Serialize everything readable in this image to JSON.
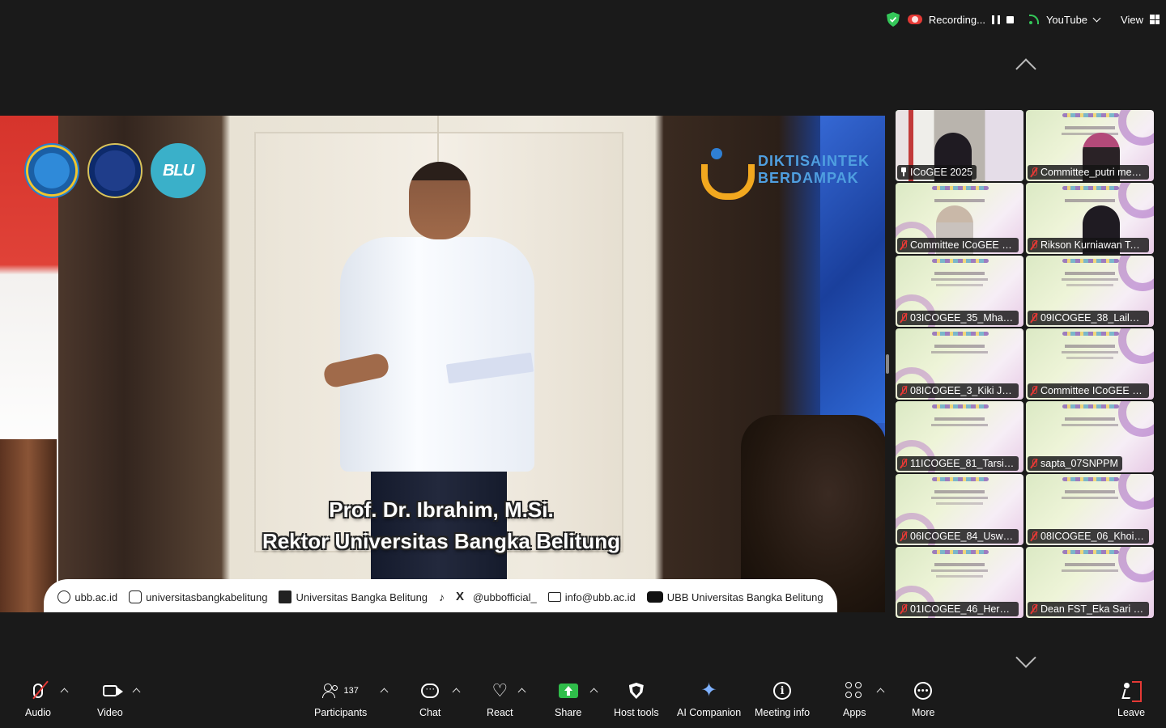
{
  "status_bar": {
    "recording_label": "Recording...",
    "livestream_label": "YouTube",
    "view_label": "View",
    "accent_green": "#34c759",
    "recording_color": "#e53935"
  },
  "main_video": {
    "caption_name": "Prof. Dr. Ibrahim, M.Si.",
    "caption_title": "Rektor Universitas Bangka Belitung",
    "logo_blu": "BLU",
    "brand_line1": "DIKTISAINTEK",
    "brand_line2": "BERDAMPAK",
    "footer": {
      "website": "ubb.ac.id",
      "instagram": "universitasbangkabelitung",
      "facebook": "Universitas Bangka Belitung",
      "tiktok_x": "@ubbofficial_",
      "email": "info@ubb.ac.id",
      "youtube": "UBB Universitas Bangka Belitung"
    }
  },
  "gallery": [
    {
      "name": "ICoGEE 2025",
      "pinned": true,
      "active": true
    },
    {
      "name": "Committee_putri men...",
      "muted": true
    },
    {
      "name": "Committee ICoGEE 20...",
      "muted": true
    },
    {
      "name": "Rikson Kurniawan Tan...",
      "muted": true
    },
    {
      "name": "03ICOGEE_35_Mham...",
      "muted": true
    },
    {
      "name": "09ICOGEE_38_Lailatu...",
      "muted": true
    },
    {
      "name": "08ICOGEE_3_Kiki Ju...",
      "muted": true
    },
    {
      "name": "Committee ICoGEE 20...",
      "muted": true
    },
    {
      "name": "11ICOGEE_81_Tarsisiu...",
      "muted": true
    },
    {
      "name": "sapta_07SNPPM",
      "muted": true
    },
    {
      "name": "06ICOGEE_84_Uswat...",
      "muted": true
    },
    {
      "name": "08ICOGEE_06_Khoiru...",
      "muted": true
    },
    {
      "name": "01ICOGEE_46_Herma...",
      "muted": true
    },
    {
      "name": "Dean FST_Eka Sari Wi...",
      "muted": true
    }
  ],
  "toolbar": {
    "audio": "Audio",
    "video": "Video",
    "participants": "Participants",
    "participant_count": "137",
    "chat": "Chat",
    "react": "React",
    "share": "Share",
    "host_tools": "Host tools",
    "ai_companion": "AI Companion",
    "meeting_info": "Meeting info",
    "apps": "Apps",
    "more": "More",
    "leave": "Leave"
  }
}
